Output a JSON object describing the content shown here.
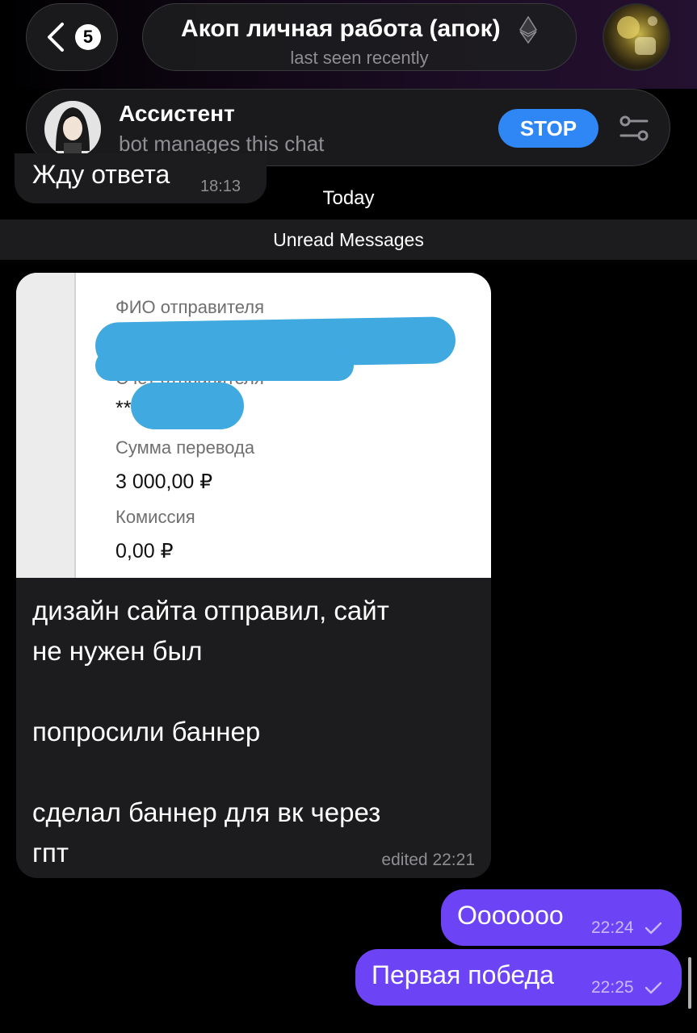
{
  "header": {
    "back_count": "5",
    "title": "Акоп личная работа (апок)",
    "status": "last seen recently"
  },
  "bot_bar": {
    "name": "Ассистент",
    "subtitle": "bot manages this chat",
    "stop_label": "STOP"
  },
  "messages": {
    "previous": {
      "text": "Жду ответа",
      "time": "18:13"
    },
    "day_label": "Today",
    "unread_label": "Unread Messages",
    "photo_message": {
      "receipt": {
        "sender_label": "ФИО отправителя",
        "account_label": "Счёт отправителя",
        "account_value": "**",
        "amount_label": "Сумма перевода",
        "amount_value": "3 000,00 ₽",
        "fee_label": "Комиссия",
        "fee_value": "0,00 ₽"
      },
      "text": "дизайн сайта отправил, сайт\nне нужен был\n\nпопросили баннер\n\nсделал баннер для вк через\nгпт",
      "meta": "edited 22:21"
    },
    "outgoing": [
      {
        "text": "Ооооооо",
        "time": "22:24"
      },
      {
        "text": "Первая победа",
        "time": "22:25"
      }
    ]
  },
  "colors": {
    "accent_outgoing": "#6d44f5",
    "stop_button": "#2f87f5",
    "incoming_bubble": "#1c1c1e"
  }
}
